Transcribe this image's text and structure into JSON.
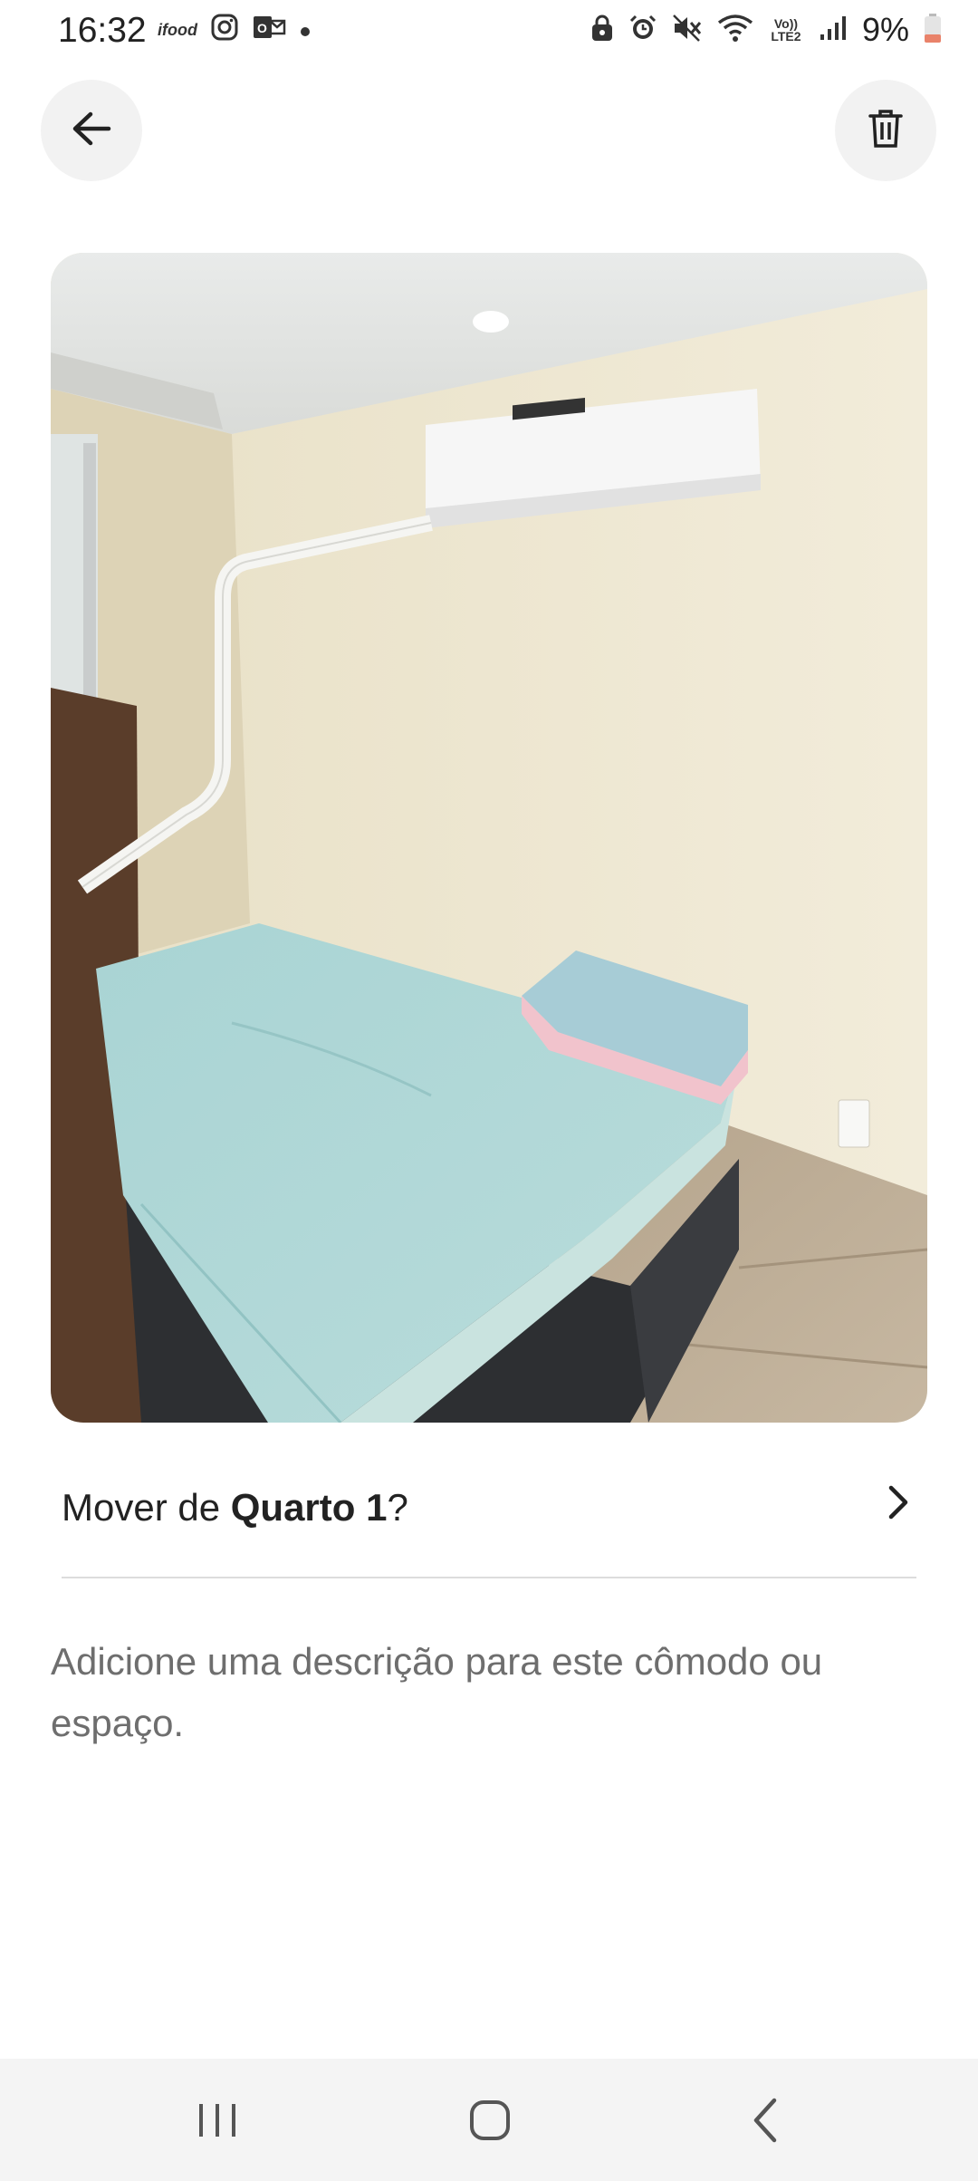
{
  "status_bar": {
    "time": "16:32",
    "left_icons": [
      "ifood-icon",
      "instagram-icon",
      "outlook-icon",
      "dot-icon"
    ],
    "right_icons": [
      "lock-icon",
      "alarm-icon",
      "mute-icon",
      "wifi-icon",
      "volte-icon",
      "signal-icon"
    ],
    "volte_label": "Vo)) LTE2",
    "ifood_label": "ifood",
    "battery": "9%"
  },
  "header": {
    "back_icon": "arrow-left-icon",
    "delete_icon": "trash-icon"
  },
  "photo": {
    "subject": "bedroom-photo"
  },
  "move": {
    "prefix": "Mover de ",
    "room": "Quarto 1",
    "suffix": "?"
  },
  "description": {
    "placeholder": "Adicione uma descrição para este cômodo ou espaço."
  },
  "nav_bar": {
    "items": [
      "recent-apps-icon",
      "home-icon",
      "back-icon"
    ]
  }
}
